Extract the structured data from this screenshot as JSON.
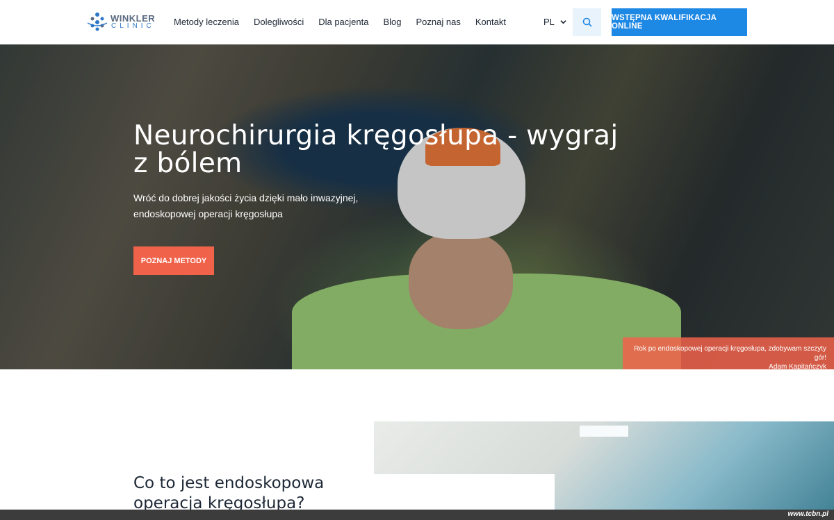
{
  "header": {
    "logo": {
      "word": "WINKLER",
      "sub": "CLINIC"
    },
    "nav": [
      "Metody leczenia",
      "Dolegliwości",
      "Dla pacjenta",
      "Blog",
      "Poznaj nas",
      "Kontakt"
    ],
    "lang": "PL",
    "cta": "WSTĘPNA KWALIFIKACJA ONLINE"
  },
  "hero": {
    "title": "Neurochirurgia kręgosłupa - wygraj z bólem",
    "subtitle": "Wróć do dobrej jakości życia dzięki mało inwazyjnej, endoskopowej operacji kręgosłupa",
    "button": "POZNAJ METODY",
    "caption_line1": "Rok po endoskopowej operacji kręgosłupa, zdobywam szczyty gór!",
    "caption_line2": "Adam Kapitańczyk"
  },
  "section": {
    "heading": "Co to jest endoskopowa operacja kręgosłupa?"
  },
  "watermark": "www.tcbn.pl",
  "colors": {
    "primary": "#1e88e5",
    "accent": "#f0624a",
    "text": "#1d2735"
  }
}
